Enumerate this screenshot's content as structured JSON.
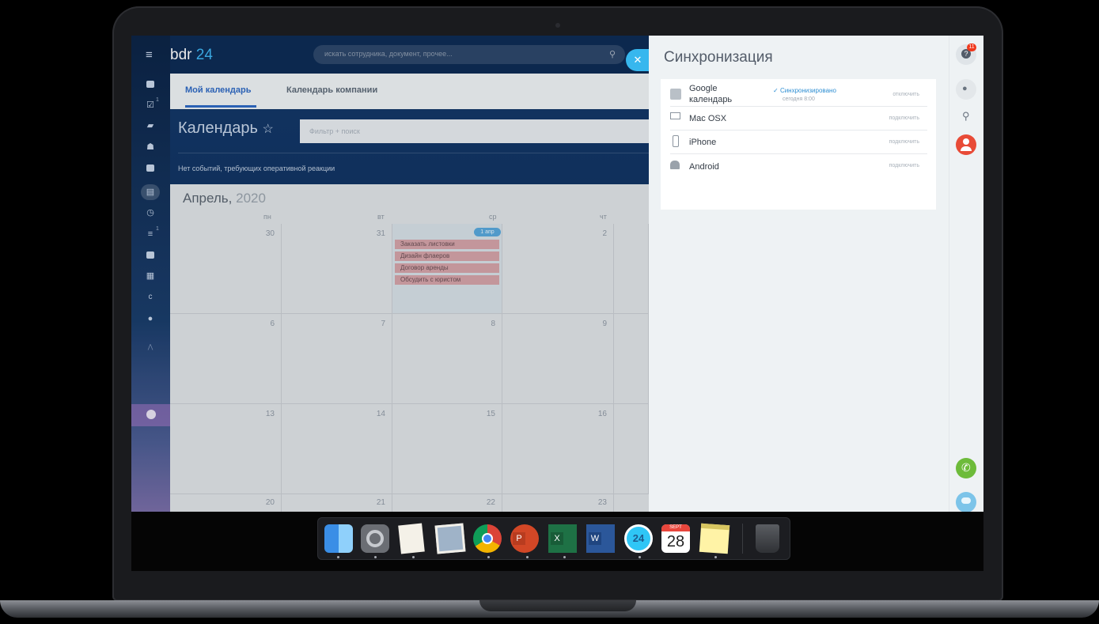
{
  "colors": {
    "accent": "#2f6ac4",
    "brand_light": "#3fb6f3",
    "sync_ok": "#2f8fd3",
    "event_bg": "#d4a3a9",
    "badge": "#f0371b"
  },
  "app": {
    "logo_text": "bdr",
    "logo_number": "24",
    "search_placeholder": "искать сотрудника, документ, прочее..."
  },
  "sidebar": {
    "icons": [
      "newsfeed-icon",
      "tasks-icon",
      "chat-icon",
      "groups-icon",
      "drive-icon",
      "calendar-icon",
      "time-icon",
      "crm-icon",
      "sites-icon",
      "mail-icon",
      "c-icon",
      "check-icon"
    ],
    "tasks_badge": "1",
    "crm_badge": "1"
  },
  "tabs": [
    "Мой календарь",
    "Календарь компании"
  ],
  "calendar": {
    "title": "Календарь",
    "filter_placeholder": "Фильтр + поиск",
    "notice": "Нет событий, требующих оперативной реакции",
    "month": "Апрель,",
    "year": "2020",
    "day_names": [
      "пн",
      "вт",
      "ср",
      "чт"
    ],
    "weeks": [
      [
        "30",
        "31",
        "1",
        "2"
      ],
      [
        "6",
        "7",
        "8",
        "9"
      ],
      [
        "13",
        "14",
        "15",
        "16"
      ],
      [
        "20",
        "21",
        "22",
        "23"
      ]
    ],
    "today_chip": "1 апр",
    "events": [
      "Заказать листовки",
      "Дизайн флаеров",
      "Договор аренды",
      "Обсудить с юристом"
    ]
  },
  "sync_panel": {
    "title": "Синхронизация",
    "rows": [
      {
        "name_line1": "Google",
        "name_line2": "календарь",
        "status": "Синхронизировано",
        "status_sub": "сегодня 8:00",
        "action": "отключить",
        "icon": "google-calendar-icon"
      },
      {
        "name": "Mac OSX",
        "action": "подключить",
        "icon": "monitor-icon"
      },
      {
        "name": "iPhone",
        "action": "подключить",
        "icon": "phone-icon"
      },
      {
        "name": "Android",
        "action": "подключить",
        "icon": "android-icon"
      }
    ]
  },
  "right_rail": {
    "help_badge": "11",
    "icons": [
      "help-icon",
      "bell-icon",
      "search-icon",
      "user-icon",
      "phone-call-icon",
      "open-lines-icon"
    ]
  },
  "dock": {
    "apps": [
      "finder-icon",
      "system-preferences-icon",
      "textedit-icon",
      "preview-icon",
      "chrome-icon",
      "powerpoint-icon",
      "excel-icon",
      "word-icon",
      "bitrix24-icon",
      "calendar-app-icon",
      "notes-icon",
      "trash-icon"
    ],
    "bitrix_label": "24",
    "calendar_month": "SEPT",
    "calendar_day": "28"
  }
}
